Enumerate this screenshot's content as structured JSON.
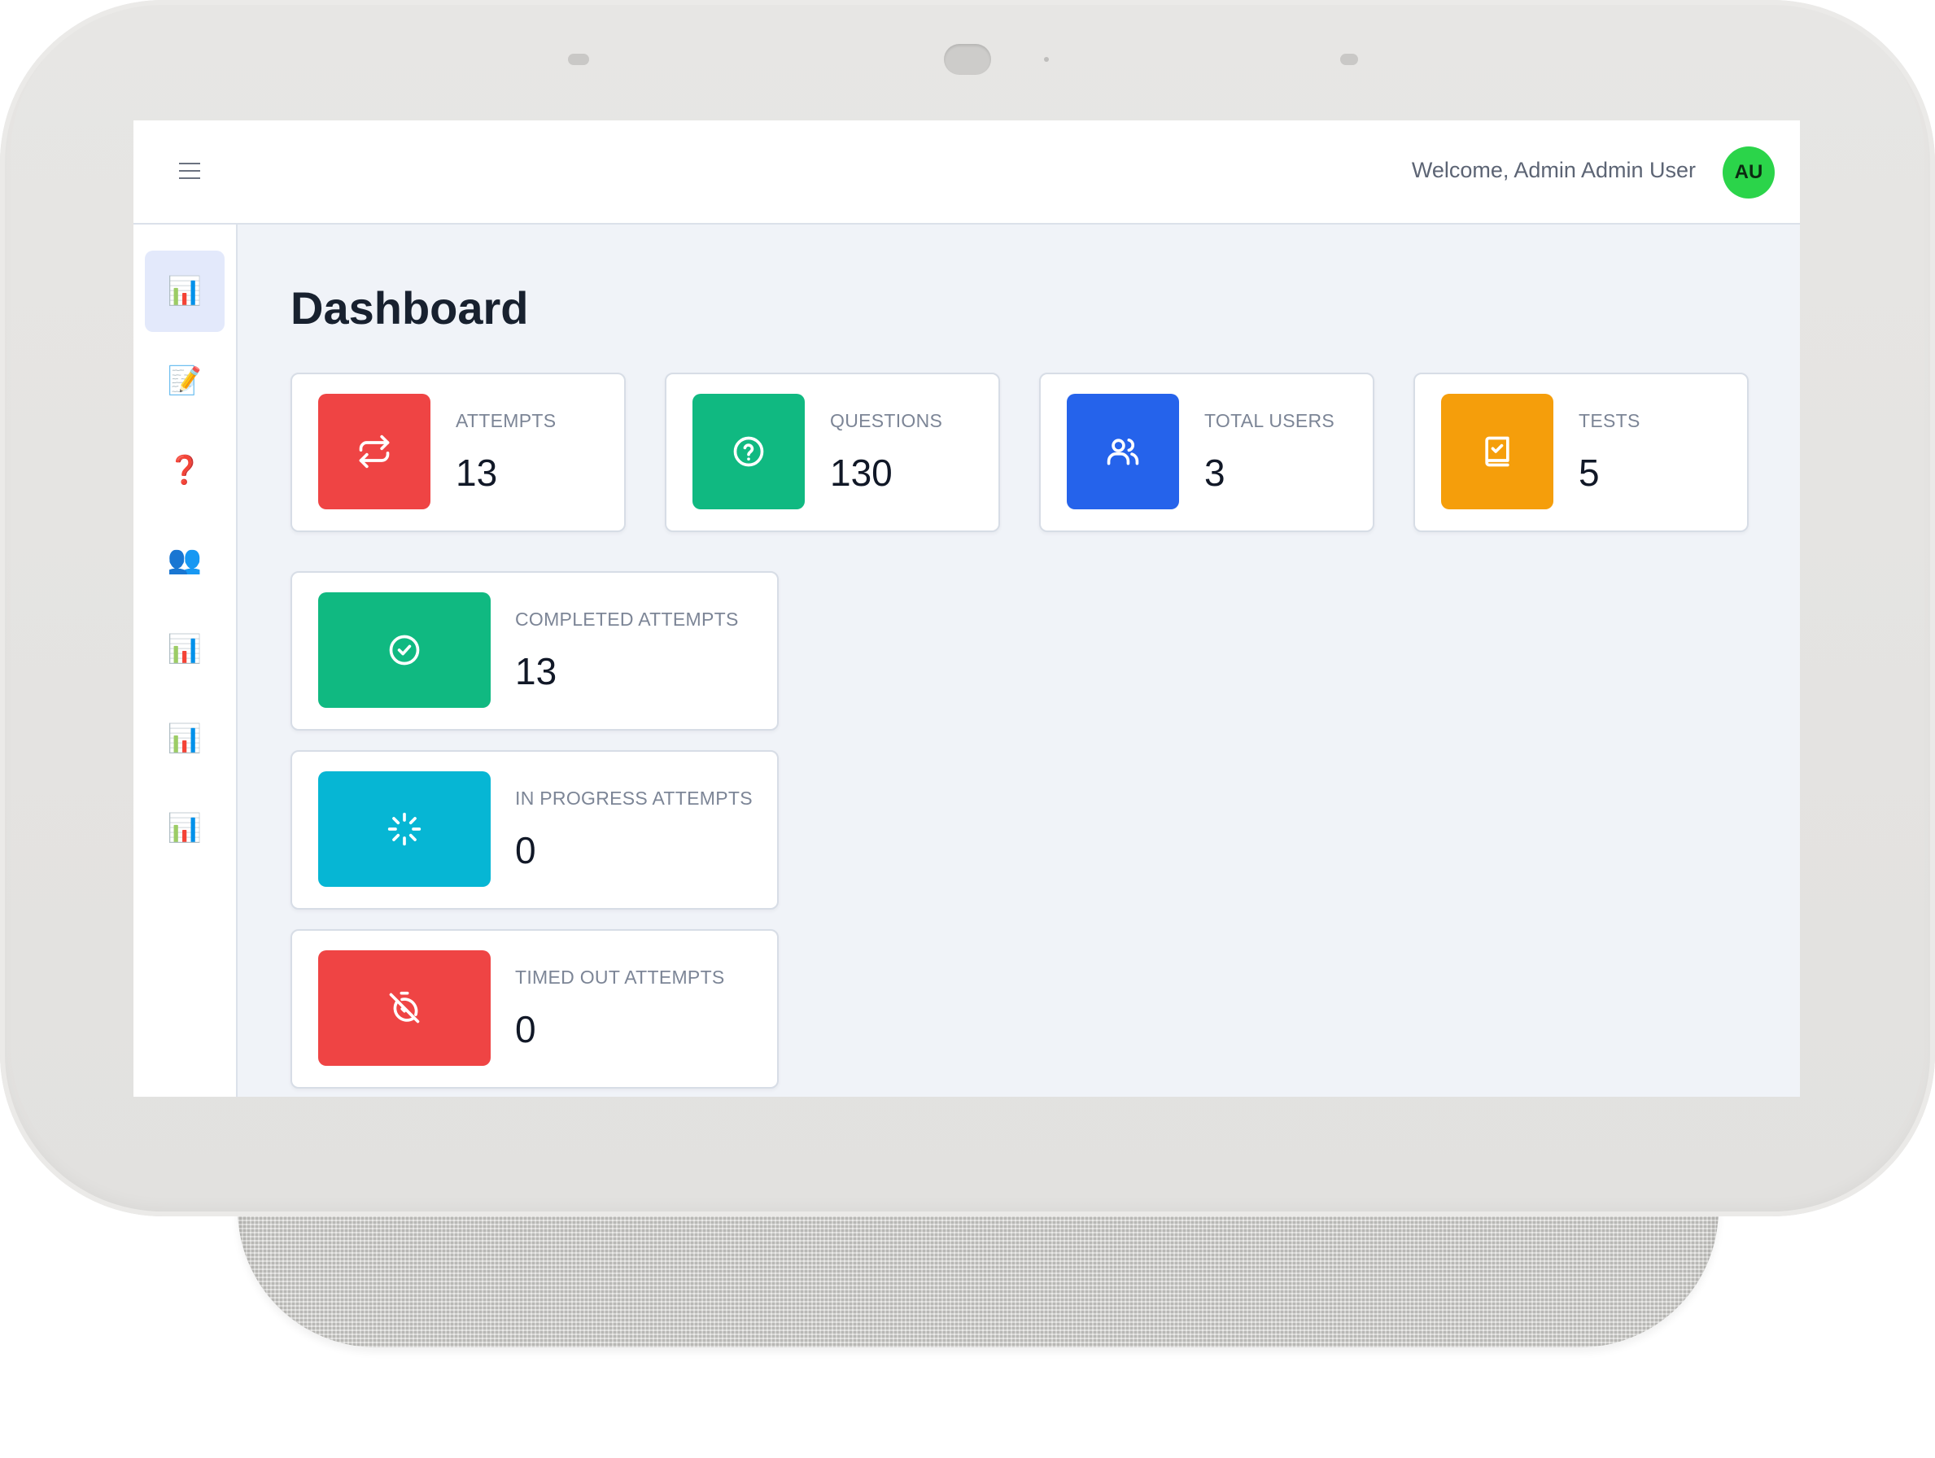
{
  "topbar": {
    "menu_icon": "hamburger-menu-icon",
    "welcome_text": "Welcome, Admin Admin User",
    "avatar_initials": "AU",
    "avatar_color": "#2bd44a"
  },
  "sidebar": {
    "items": [
      {
        "icon": "bar-chart-icon",
        "glyph": "📊",
        "active": true
      },
      {
        "icon": "memo-icon",
        "glyph": "📝",
        "active": false
      },
      {
        "icon": "question-mark-icon",
        "glyph": "❓",
        "active": false
      },
      {
        "icon": "users-icon",
        "glyph": "👥",
        "active": false
      },
      {
        "icon": "bar-chart-icon",
        "glyph": "📊",
        "active": false
      },
      {
        "icon": "bar-chart-icon",
        "glyph": "📊",
        "active": false
      },
      {
        "icon": "bar-chart-icon",
        "glyph": "📊",
        "active": false
      }
    ]
  },
  "main": {
    "title": "Dashboard",
    "stats": [
      {
        "label": "ATTEMPTS",
        "value": "13",
        "icon": "repeat-arrows-icon",
        "color": "#ef4444"
      },
      {
        "label": "QUESTIONS",
        "value": "130",
        "icon": "question-circle-icon",
        "color": "#10b981"
      },
      {
        "label": "TOTAL USERS",
        "value": "3",
        "icon": "users-icon",
        "color": "#2563eb"
      },
      {
        "label": "TESTS",
        "value": "5",
        "icon": "book-check-icon",
        "color": "#f59e0b"
      }
    ],
    "attempt_stats": [
      {
        "label": "COMPLETED ATTEMPTS",
        "value": "13",
        "icon": "check-circle-icon",
        "color": "#10b981"
      },
      {
        "label": "IN PROGRESS ATTEMPTS",
        "value": "0",
        "icon": "loader-icon",
        "color": "#06b6d4"
      },
      {
        "label": "TIMED OUT ATTEMPTS",
        "value": "0",
        "icon": "timer-off-icon",
        "color": "#ef4444"
      }
    ]
  }
}
